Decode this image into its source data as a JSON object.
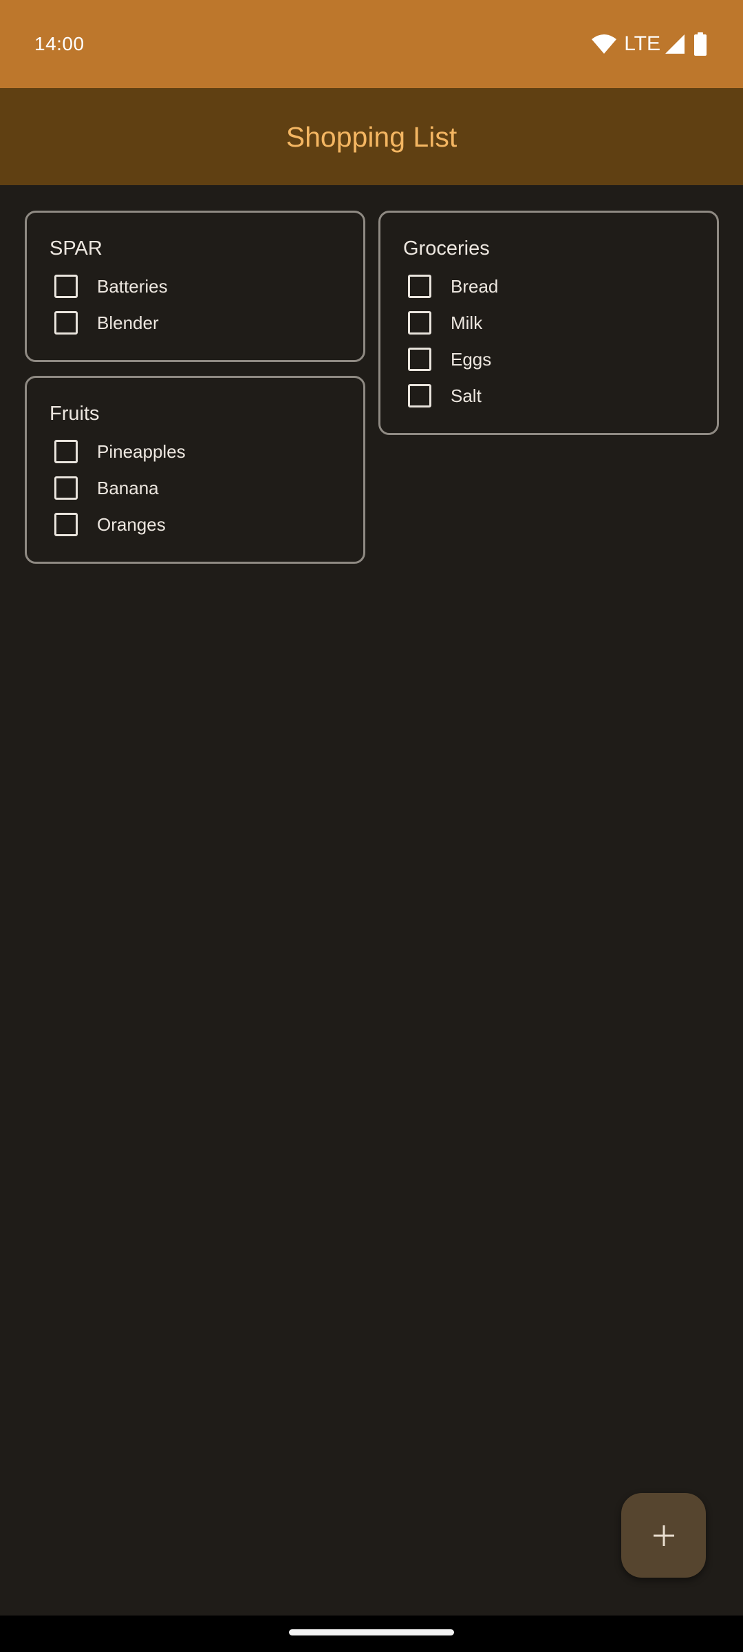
{
  "status_bar": {
    "time": "14:00",
    "network": "LTE",
    "icons": [
      "wifi-icon",
      "cell-signal-icon",
      "battery-icon"
    ]
  },
  "app_bar": {
    "title": "Shopping List"
  },
  "lists": {
    "spar": {
      "title": "SPAR",
      "items": [
        {
          "label": "Batteries",
          "checked": false
        },
        {
          "label": "Blender",
          "checked": false
        }
      ]
    },
    "fruits": {
      "title": "Fruits",
      "items": [
        {
          "label": "Pineapples",
          "checked": false
        },
        {
          "label": "Banana",
          "checked": false
        },
        {
          "label": "Oranges",
          "checked": false
        }
      ]
    },
    "groceries": {
      "title": "Groceries",
      "items": [
        {
          "label": "Bread",
          "checked": false
        },
        {
          "label": "Milk",
          "checked": false
        },
        {
          "label": "Eggs",
          "checked": false
        },
        {
          "label": "Salt",
          "checked": false
        }
      ]
    }
  },
  "fab": {
    "icon": "plus-icon"
  },
  "colors": {
    "status_bar": "#bd772c",
    "app_bar": "#604012",
    "title": "#f4b662",
    "background": "#1f1c18",
    "card_border": "#8f8a83",
    "fab": "#56452f"
  }
}
